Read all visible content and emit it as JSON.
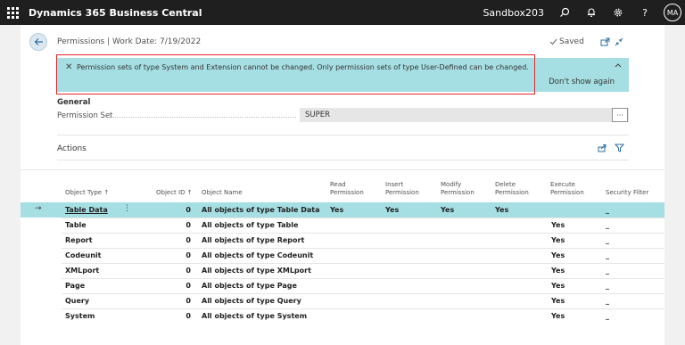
{
  "topbar": {
    "app_title": "Dynamics 365 Business Central",
    "environment": "Sandbox203",
    "avatar_initials": "MA",
    "help_glyph": "?"
  },
  "page": {
    "caption": "Permissions | Work Date: 7/19/2022",
    "saved_label": "Saved"
  },
  "banner": {
    "close_glyph": "✕",
    "message": "Permission sets of type System and Extension cannot be changed. Only permission sets of type User-Defined can be changed.",
    "link": "Don't show again"
  },
  "general": {
    "title": "General",
    "permission_set_label": "Permission Set",
    "permission_set_value": "SUPER",
    "ellipsis": "···"
  },
  "actions_label": "Actions",
  "table": {
    "columns": {
      "object_type": "Object Type ↑",
      "object_id": "Object ID ↑",
      "object_name": "Object Name",
      "read": [
        "Read",
        "Permission"
      ],
      "insert": [
        "Insert",
        "Permission"
      ],
      "modify": [
        "Modify",
        "Permission"
      ],
      "delete": [
        "Delete",
        "Permission"
      ],
      "execute": [
        "Execute",
        "Permission"
      ],
      "security": "Security Filter"
    },
    "rows": [
      {
        "type": "Table Data",
        "id": "0",
        "name": "All objects of type Table Data",
        "read": "Yes",
        "insert": "Yes",
        "modify": "Yes",
        "delete": "Yes",
        "execute": "",
        "filter": "_"
      },
      {
        "type": "Table",
        "id": "0",
        "name": "All objects of type Table",
        "read": "",
        "insert": "",
        "modify": "",
        "delete": "",
        "execute": "Yes",
        "filter": "_"
      },
      {
        "type": "Report",
        "id": "0",
        "name": "All objects of type Report",
        "read": "",
        "insert": "",
        "modify": "",
        "delete": "",
        "execute": "Yes",
        "filter": "_"
      },
      {
        "type": "Codeunit",
        "id": "0",
        "name": "All objects of type Codeunit",
        "read": "",
        "insert": "",
        "modify": "",
        "delete": "",
        "execute": "Yes",
        "filter": "_"
      },
      {
        "type": "XMLport",
        "id": "0",
        "name": "All objects of type XMLport",
        "read": "",
        "insert": "",
        "modify": "",
        "delete": "",
        "execute": "Yes",
        "filter": "_"
      },
      {
        "type": "Page",
        "id": "0",
        "name": "All objects of type Page",
        "read": "",
        "insert": "",
        "modify": "",
        "delete": "",
        "execute": "Yes",
        "filter": "_"
      },
      {
        "type": "Query",
        "id": "0",
        "name": "All objects of type Query",
        "read": "",
        "insert": "",
        "modify": "",
        "delete": "",
        "execute": "Yes",
        "filter": "_"
      },
      {
        "type": "System",
        "id": "0",
        "name": "All objects of type System",
        "read": "",
        "insert": "",
        "modify": "",
        "delete": "",
        "execute": "Yes",
        "filter": "_"
      }
    ],
    "selected_row": 0
  },
  "colors": {
    "banner_bg": "#a6dfe3",
    "highlight_border": "#e3252a",
    "accent": "#2b6d9e",
    "topbar_bg": "#1f1f1f"
  }
}
